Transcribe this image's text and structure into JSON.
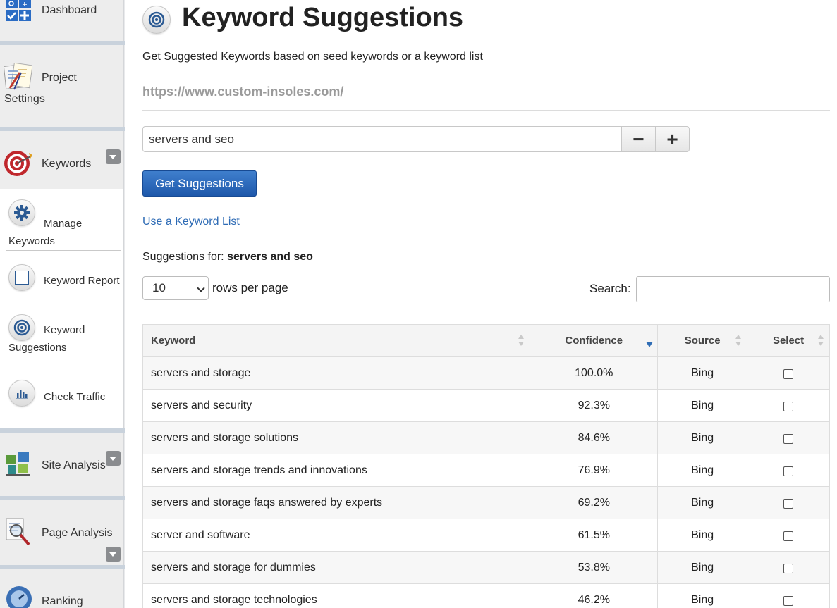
{
  "sidebar": {
    "dashboard": "Dashboard",
    "project_settings_line1": "Project",
    "project_settings_line2": "Settings",
    "keywords": "Keywords",
    "manage_keywords_line1": "Manage",
    "manage_keywords_line2": "Keywords",
    "keyword_report": "Keyword Report",
    "keyword_suggestions_line1": "Keyword",
    "keyword_suggestions_line2": "Suggestions",
    "check_traffic": "Check Traffic",
    "site_analysis": "Site Analysis",
    "page_analysis": "Page Analysis",
    "ranking": "Ranking"
  },
  "page": {
    "title": "Keyword Suggestions",
    "subtitle": "Get Suggested Keywords based on seed keywords or a keyword list",
    "url": "https://www.custom-insoles.com/",
    "seed_value": "servers and seo",
    "minus_label": "−",
    "plus_label": "+",
    "get_button": "Get Suggestions",
    "keyword_list_link": "Use a Keyword List",
    "suggestions_prefix": "Suggestions for:",
    "suggestions_term": "servers and seo",
    "rows_value": "10",
    "rows_label": "rows per page",
    "search_label": "Search:",
    "search_value": ""
  },
  "table": {
    "headers": {
      "keyword": "Keyword",
      "confidence": "Confidence",
      "source": "Source",
      "select": "Select"
    },
    "rows": [
      {
        "keyword": "servers and storage",
        "confidence": "100.0%",
        "source": "Bing"
      },
      {
        "keyword": "servers and security",
        "confidence": "92.3%",
        "source": "Bing"
      },
      {
        "keyword": "servers and storage solutions",
        "confidence": "84.6%",
        "source": "Bing"
      },
      {
        "keyword": "servers and storage trends and innovations",
        "confidence": "76.9%",
        "source": "Bing"
      },
      {
        "keyword": "servers and storage faqs answered by experts",
        "confidence": "69.2%",
        "source": "Bing"
      },
      {
        "keyword": "server and software",
        "confidence": "61.5%",
        "source": "Bing"
      },
      {
        "keyword": "servers and storage for dummies",
        "confidence": "53.8%",
        "source": "Bing"
      },
      {
        "keyword": "servers and storage technologies",
        "confidence": "46.2%",
        "source": "Bing"
      }
    ]
  },
  "colors": {
    "primary_button": "#1e58ab",
    "link": "#2e6bb5",
    "sort_active": "#2f6db5"
  }
}
